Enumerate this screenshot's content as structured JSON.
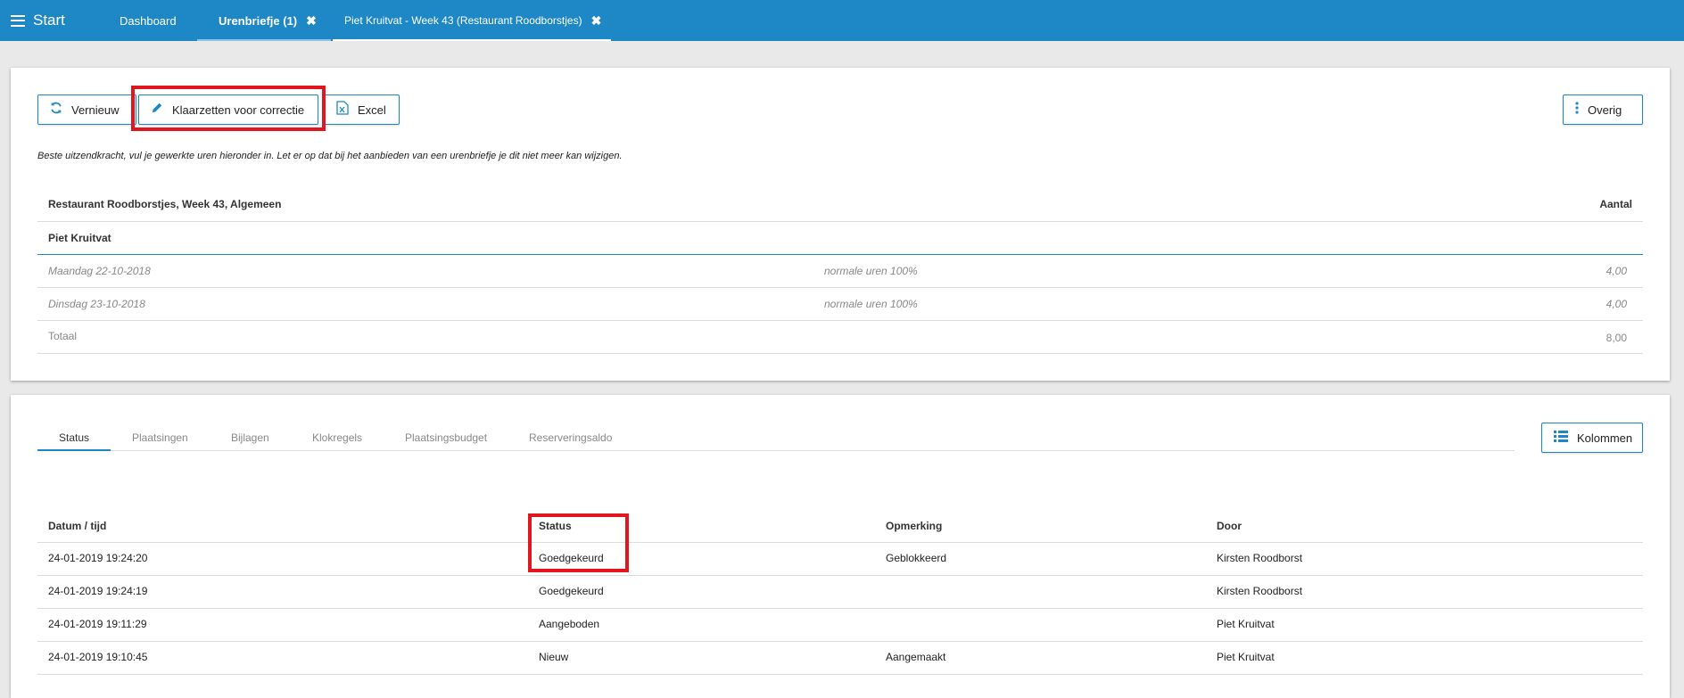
{
  "topbar": {
    "menu_label": "Start",
    "tabs": [
      {
        "label": "Dashboard"
      },
      {
        "label": "Urenbriefje (1)",
        "close": "✖"
      },
      {
        "label": "Piet Kruitvat - Week 43 (Restaurant Roodborstjes)",
        "close": "✖"
      }
    ]
  },
  "toolbar": {
    "vernieuw": "Vernieuw",
    "klaarzetten": "Klaarzetten voor correctie",
    "excel": "Excel",
    "overig": "Overig"
  },
  "note": "Beste uitzendkracht, vul je gewerkte uren hieronder in. Let er op dat bij het aanbieden van een urenbriefje je dit niet meer kan wijzigen.",
  "hours_table": {
    "title": "Restaurant Roodborstjes, Week 43, Algemeen",
    "aantal_header": "Aantal",
    "person": "Piet Kruitvat",
    "rows": [
      {
        "day": "Maandag 22-10-2018",
        "type": "normale uren 100%",
        "amount": "4,00"
      },
      {
        "day": "Dinsdag 23-10-2018",
        "type": "normale uren 100%",
        "amount": "4,00"
      }
    ],
    "total_label": "Totaal",
    "total_amount": "8,00"
  },
  "bottom_tabs": [
    "Status",
    "Plaatsingen",
    "Bijlagen",
    "Klokregels",
    "Plaatsingsbudget",
    "Reserveringsaldo"
  ],
  "kolommen": "Kolommen",
  "status_table": {
    "headers": [
      "Datum / tijd",
      "Status",
      "Opmerking",
      "Door"
    ],
    "rows": [
      [
        "24-01-2019 19:24:20",
        "Goedgekeurd",
        "Geblokkeerd",
        "Kirsten Roodborst"
      ],
      [
        "24-01-2019 19:24:19",
        "Goedgekeurd",
        "",
        "Kirsten Roodborst"
      ],
      [
        "24-01-2019 19:11:29",
        "Aangeboden",
        "",
        "Piet Kruitvat"
      ],
      [
        "24-01-2019 19:10:45",
        "Nieuw",
        "Aangemaakt",
        "Piet Kruitvat"
      ]
    ]
  },
  "colors": {
    "accent": "#1e88c7",
    "highlight": "#e0171e"
  }
}
